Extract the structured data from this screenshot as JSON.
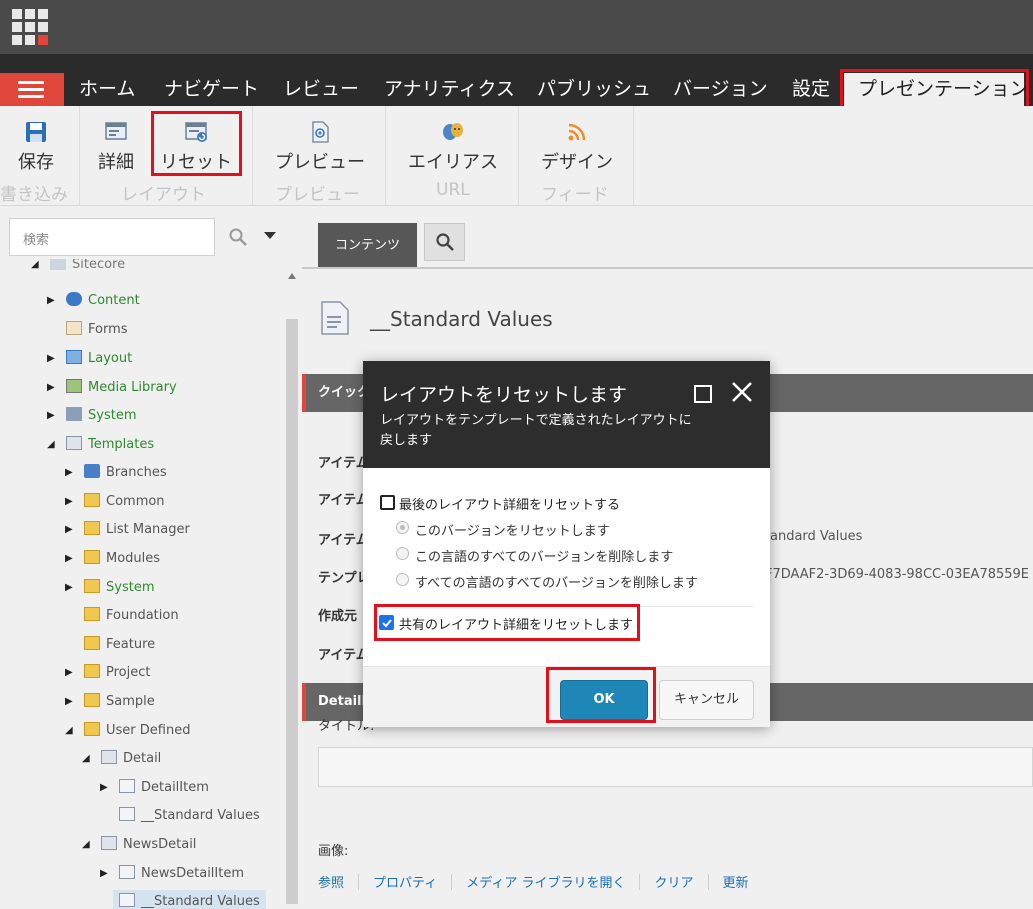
{
  "topbar": {
    "app_grid_icon": "app-grid-icon"
  },
  "menu": {
    "tabs": [
      "ホーム",
      "ナビゲート",
      "レビュー",
      "アナリティクス",
      "パブリッシュ",
      "バージョン",
      "設定",
      "プレゼンテーション"
    ]
  },
  "ribbon": {
    "save": "保存",
    "details": "詳細",
    "reset": "リセット",
    "preview": "プレビュー",
    "aliases": "エイリアス",
    "design": "デザイン",
    "groups": {
      "write": "書き込み",
      "layout": "レイアウト",
      "preview": "プレビュー",
      "url": "URL",
      "feed": "フィード"
    }
  },
  "tree": {
    "search_placeholder": "検索",
    "root": "Sitecore",
    "items": [
      {
        "label": "Content",
        "color": "green"
      },
      {
        "label": "Forms",
        "color": "gray"
      },
      {
        "label": "Layout",
        "color": "green"
      },
      {
        "label": "Media Library",
        "color": "green"
      },
      {
        "label": "System",
        "color": "green"
      },
      {
        "label": "Templates",
        "color": "green"
      },
      {
        "label": "Branches",
        "color": "gray"
      },
      {
        "label": "Common",
        "color": "gray"
      },
      {
        "label": "List Manager",
        "color": "gray"
      },
      {
        "label": "Modules",
        "color": "gray"
      },
      {
        "label": "System",
        "color": "green"
      },
      {
        "label": "Foundation",
        "color": "gray"
      },
      {
        "label": "Feature",
        "color": "gray"
      },
      {
        "label": "Project",
        "color": "gray"
      },
      {
        "label": "Sample",
        "color": "gray"
      },
      {
        "label": "User Defined",
        "color": "gray"
      },
      {
        "label": "Detail",
        "color": "gray"
      },
      {
        "label": "DetailItem",
        "color": "gray"
      },
      {
        "label": "__Standard Values",
        "color": "gray"
      },
      {
        "label": "NewsDetail",
        "color": "gray"
      },
      {
        "label": "NewsDetailItem",
        "color": "gray"
      },
      {
        "label": "__Standard Values",
        "color": "gray"
      }
    ]
  },
  "content": {
    "tab": "コンテンツ",
    "item_title": "__Standard Values",
    "section_quick": "クイック",
    "fields": [
      "アイテム",
      "アイテム",
      "アイテム",
      "テンプレ",
      "作成元",
      "アイテム"
    ],
    "value_path": "andard Values",
    "value_template": "F7DAAF2-3D69-4083-98CC-03EA78559E",
    "section_detail": "DetailI",
    "title_label": "タイトル:",
    "image_label": "画像:",
    "links": [
      "参照",
      "プロパティ",
      "メディア ライブラリを開く",
      "クリア",
      "更新"
    ]
  },
  "dialog": {
    "title": "レイアウトをリセットします",
    "subtitle": "レイアウトをテンプレートで定義されたレイアウトに戻します",
    "reset_final": "最後のレイアウト詳細をリセットする",
    "radio1": "このバージョンをリセットします",
    "radio2": "この言語のすべてのバージョンを削除します",
    "radio3": "すべての言語のすべてのバージョンを削除します",
    "reset_shared": "共有のレイアウト詳細をリセットします",
    "ok": "OK",
    "cancel": "キャンセル"
  },
  "colors": {
    "accent_red": "#e0463a",
    "highlight_red": "#e2101b",
    "ok_blue": "#1f86b8",
    "tree_green": "#2e8a2e"
  }
}
